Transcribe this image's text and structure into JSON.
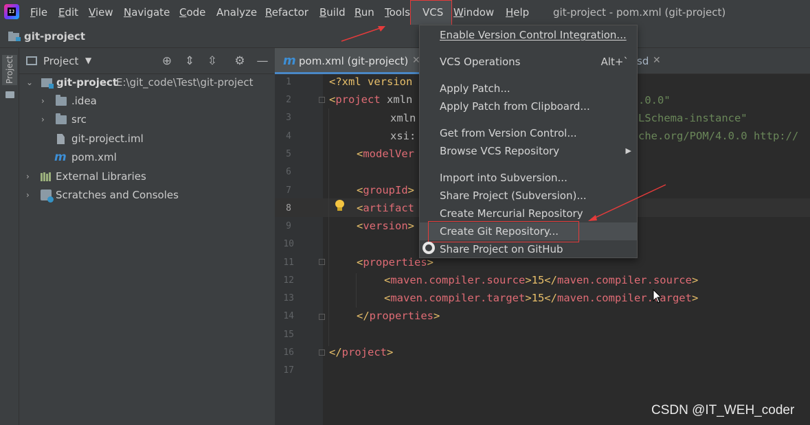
{
  "menubar": {
    "items": [
      "File",
      "Edit",
      "View",
      "Navigate",
      "Code",
      "Analyze",
      "Refactor",
      "Build",
      "Run",
      "Tools",
      "VCS",
      "Window",
      "Help"
    ],
    "window_title": "git-project - pom.xml (git-project)",
    "app_icon_text": "IJ"
  },
  "navbar": {
    "project": "git-project"
  },
  "left_strip": {
    "label": "Project"
  },
  "project_panel": {
    "title": "Project",
    "tree": [
      {
        "label": "git-project",
        "path": "E:\\git_code\\Test\\git-project"
      },
      {
        "label": ".idea"
      },
      {
        "label": "src"
      },
      {
        "label": "git-project.iml"
      },
      {
        "label": "pom.xml"
      },
      {
        "label": "External Libraries"
      },
      {
        "label": "Scratches and Consoles"
      }
    ]
  },
  "editor_tabs": {
    "active": "pom.xml (git-project)",
    "second_suffix": "sd"
  },
  "editor": {
    "line_numbers": [
      "1",
      "2",
      "3",
      "4",
      "5",
      "6",
      "7",
      "8",
      "9",
      "10",
      "11",
      "12",
      "13",
      "14",
      "15",
      "16",
      "17"
    ],
    "lines": {
      "l1": "<?xml version",
      "l1r": ".0.0\"",
      "l2a": "<",
      "l2b": "project",
      "l2c": " xmln",
      "l2r": "LSchema-instance\"",
      "l3": "xmln",
      "l4": "xsi:",
      "l4r": "che.org/POM/4.0.0 http://",
      "l5a": "<",
      "l5b": "modelVer",
      "l7a": "<",
      "l7b": "groupId",
      "l7c": ">",
      "l8a": "<",
      "l8b": "artifact",
      "l9a": "<",
      "l9b": "version",
      "l9c": ">",
      "l11a": "<",
      "l11b": "properties",
      "l11c": ">",
      "l12a": "<",
      "l12b": "maven.compiler.source",
      "l12c": ">15</",
      "l12d": "maven.compiler.source",
      "l12e": ">",
      "l13a": "<",
      "l13b": "maven.compiler.target",
      "l13c": ">15</",
      "l13d": "maven.compile",
      "l13d2": "r.target",
      "l13e": ">",
      "l14a": "</",
      "l14b": "properties",
      "l14c": ">",
      "l16a": "</",
      "l16b": "project",
      "l16c": ">"
    }
  },
  "vcs_menu": {
    "items": [
      {
        "label": "Enable Version Control Integration..."
      },
      {
        "label": "VCS Operations",
        "shortcut": "Alt+`"
      },
      {
        "label": "Apply Patch..."
      },
      {
        "label": "Apply Patch from Clipboard..."
      },
      {
        "label": "Get from Version Control..."
      },
      {
        "label": "Browse VCS Repository"
      },
      {
        "label": "Import into Subversion..."
      },
      {
        "label": "Share Project (Subversion)..."
      },
      {
        "label": "Create Mercurial Repository"
      },
      {
        "label": "Create Git Repository..."
      },
      {
        "label": "Share Project on GitHub"
      }
    ]
  },
  "watermark": "CSDN @IT_WEH_coder",
  "colors": {
    "accent_red": "#e53b3b",
    "tab_underline": "#4a88c7",
    "xml_tag": "#e8bf6a",
    "xml_string": "#6a8759"
  }
}
